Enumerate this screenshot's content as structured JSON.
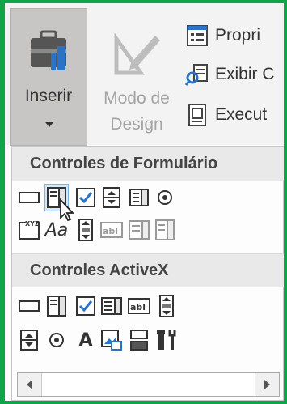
{
  "ribbon": {
    "insert_label": "Inserir",
    "design_label": "Modo de Design",
    "properties_label": "Propri",
    "view_code_label": "Exibir C",
    "run_dialog_label": "Execut"
  },
  "panel": {
    "form_controls_header": "Controles de Formulário",
    "activex_controls_header": "Controles ActiveX"
  },
  "colors": {
    "border_green": "#0fa34a",
    "check_blue": "#2b73c7",
    "hover_blue": "#d5e8f8"
  }
}
